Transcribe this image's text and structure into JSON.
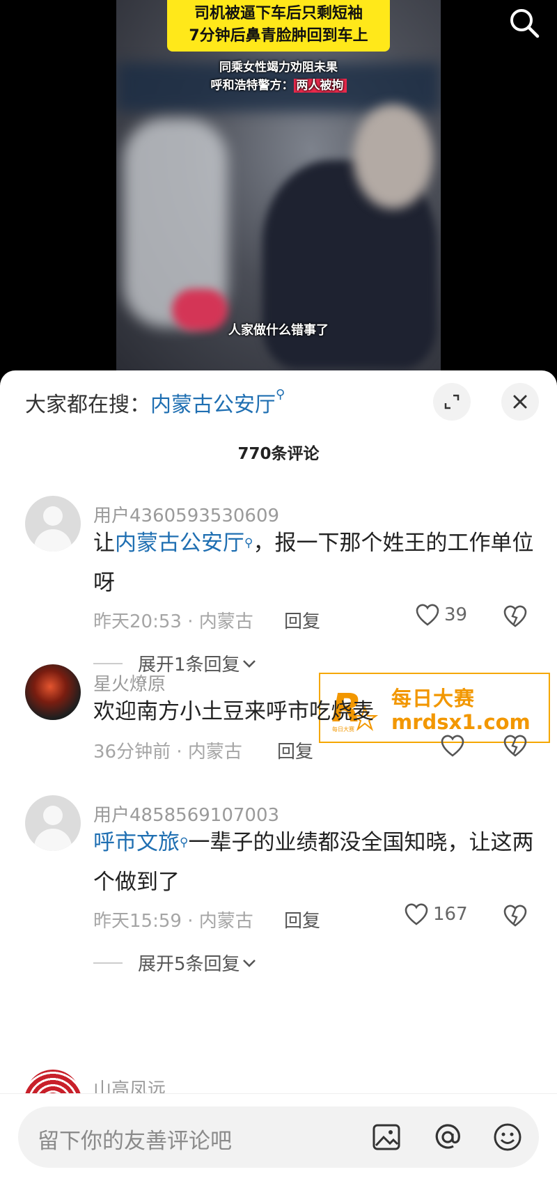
{
  "video": {
    "headline_line1": "司机被逼下车后只剩短袖",
    "headline_line2": "7分钟后鼻青脸肿回到车上",
    "sub_line1": "同乘女性竭力劝阻未果",
    "sub_line2_prefix": "呼和浩特警方：",
    "sub_line2_highlight": "两人被拘",
    "caption": "人家做什么错事了",
    "search_icon": "search-icon"
  },
  "trending": {
    "label": "大家都在搜：",
    "keyword": "内蒙古公安厅"
  },
  "comment_count": "770条评论",
  "comments": [
    {
      "user": "用户4360593530609",
      "text_keyword": "内蒙古公安厅",
      "text_prefix": "让",
      "text_suffix": "，报一下那个姓王的工作单位呀",
      "time_location": "昨天20:53 · 内蒙古",
      "reply": "回复",
      "likes": "39",
      "expand": "展开1条回复"
    },
    {
      "user": "星火燎原",
      "text": "欢迎南方小土豆来呼市吃烧麦",
      "time_location": "36分钟前 · 内蒙古",
      "reply": "回复"
    },
    {
      "user": "用户4858569107003",
      "text_keyword": "呼市文旅",
      "text_suffix": "一辈子的业绩都没全国知晓，让这两个做到了",
      "time_location": "昨天15:59 · 内蒙古",
      "reply": "回复",
      "likes": "167",
      "expand": "展开5条回复"
    },
    {
      "user": "山高凤远"
    }
  ],
  "ad": {
    "name": "每日大赛",
    "domain": "mrdsx1.com",
    "logo_text": "每日大赛"
  },
  "composer": {
    "placeholder": "留下你的友善评论吧"
  },
  "colors": {
    "link": "#1f6fb2",
    "headline_bg": "#ffe81a",
    "highlight_red": "#e8294b",
    "ad_orange": "#f29700"
  }
}
